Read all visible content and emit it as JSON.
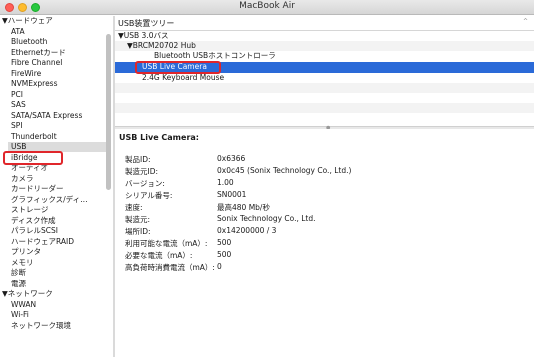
{
  "window": {
    "title": "MacBook Air"
  },
  "sidebar": {
    "hardware_group": "▼ハードウェア",
    "hardware_items": [
      "ATA",
      "Bluetooth",
      "Ethernetカード",
      "Fibre Channel",
      "FireWire",
      "NVMExpress",
      "PCI",
      "SAS",
      "SATA/SATA Express",
      "SPI",
      "Thunderbolt",
      "USB",
      "iBridge",
      "オーディオ",
      "カメラ",
      "カードリーダー",
      "グラフィックス/ディ…",
      "ストレージ",
      "ディスク作成",
      "パラレルSCSI",
      "ハードウェアRAID",
      "プリンタ",
      "メモリ",
      "診断",
      "電源"
    ],
    "selected_item": "USB",
    "network_group": "▼ネットワーク",
    "network_items": [
      "WWAN",
      "Wi-Fi",
      "ネットワーク環境"
    ]
  },
  "tree": {
    "header": "USB装置ツリー",
    "rows": [
      {
        "label": "▼USB 3.0バス"
      },
      {
        "label": "▼BRCM20702 Hub"
      },
      {
        "label": "Bluetooth USBホストコントローラ"
      },
      {
        "label": "USB Live Camera"
      },
      {
        "label": "2.4G Keyboard Mouse"
      }
    ],
    "selected": "USB Live Camera"
  },
  "detail": {
    "title": "USB Live Camera:",
    "properties": [
      {
        "label": "製品ID:",
        "value": "0x6366"
      },
      {
        "label": "製造元ID:",
        "value": "0x0c45  (Sonix Technology Co., Ltd.)"
      },
      {
        "label": "バージョン:",
        "value": "1.00"
      },
      {
        "label": "シリアル番号:",
        "value": "SN0001"
      },
      {
        "label": "速度:",
        "value": "最高480 Mb/秒"
      },
      {
        "label": "製造元:",
        "value": "Sonix Technology Co., Ltd."
      },
      {
        "label": "場所ID:",
        "value": "0x14200000 / 3"
      },
      {
        "label": "利用可能な電流（mA）:",
        "value": "500"
      },
      {
        "label": "必要な電流（mA）:",
        "value": "500"
      },
      {
        "label": "高負荷時消費電流（mA）:",
        "value": "0"
      }
    ]
  },
  "colors": {
    "selection": "#2a6ad8",
    "highlight_box": "#e0262b"
  }
}
